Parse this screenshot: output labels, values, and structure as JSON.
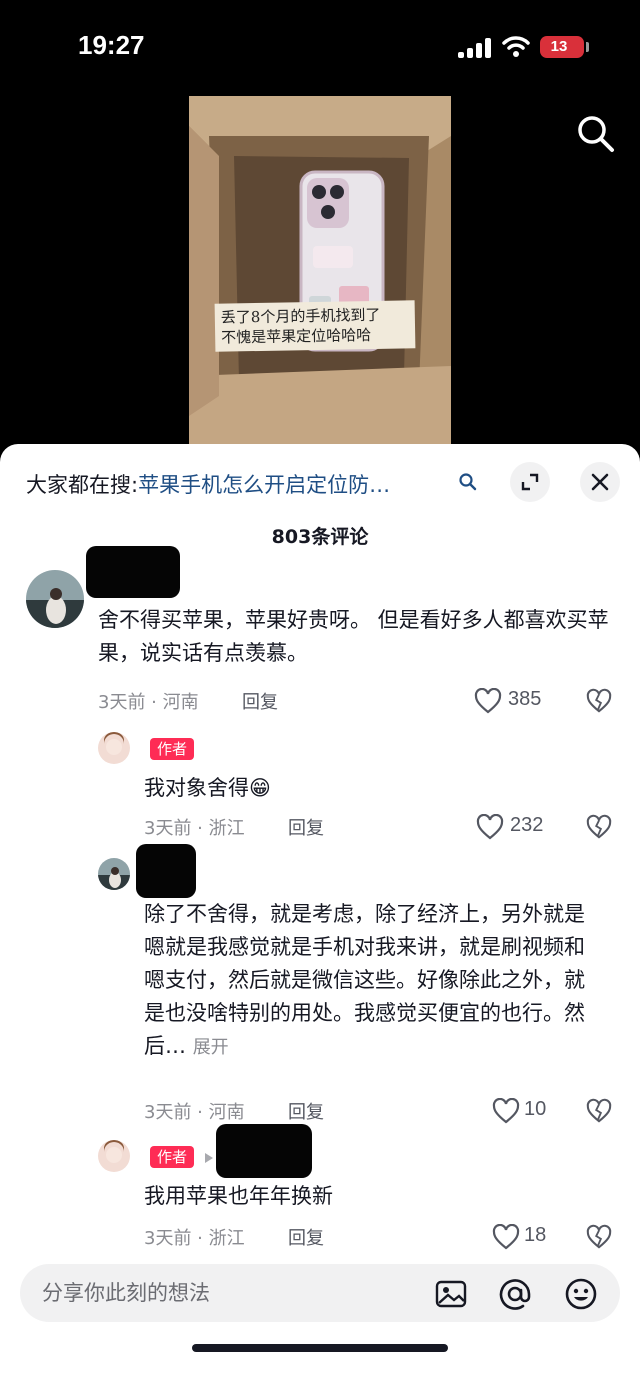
{
  "status": {
    "time": "19:27",
    "battery": "13"
  },
  "video": {
    "caption_line1": "丢了8个月的手机找到了",
    "caption_line2": "不愧是苹果定位哈哈哈"
  },
  "hot_search": {
    "prefix": "大家都在搜:",
    "query": "苹果手机怎么开启定位防…"
  },
  "comment_count": "803条评论",
  "comments": [
    {
      "text": "舍不得买苹果，苹果好贵呀。 但是看好多人都喜欢买苹果，说实话有点羡慕。",
      "time": "3天前 · 河南",
      "reply": "回复",
      "likes": "385"
    },
    {
      "badge": "作者",
      "text": "我对象舍得😁",
      "time": "3天前 · 浙江",
      "reply": "回复",
      "likes": "232"
    },
    {
      "text": "除了不舍得，就是考虑，除了经济上，另外就是嗯就是我感觉就是手机对我来讲，就是刷视频和嗯支付，然后就是微信这些。好像除此之外，就是也没啥特别的用处。我感觉买便宜的也行。然后…",
      "expand": "展开",
      "time": "3天前 · 河南",
      "reply": "回复",
      "likes": "10"
    },
    {
      "badge": "作者",
      "text": "我用苹果也年年换新",
      "time": "3天前 · 浙江",
      "reply": "回复",
      "likes": "18"
    }
  ],
  "input": {
    "placeholder": "分享你此刻的想法"
  },
  "colors": {
    "author_badge": "#fe2c55",
    "hot_query": "#1f4e84",
    "battery": "#d9303a"
  }
}
